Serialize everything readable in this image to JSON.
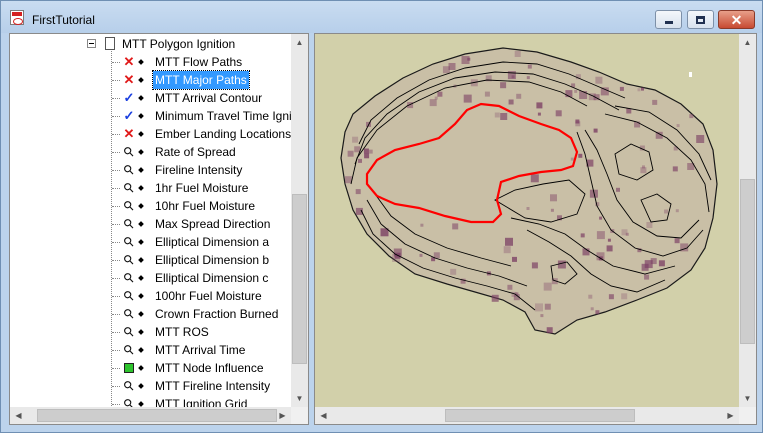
{
  "window": {
    "title": "FirstTutorial",
    "controls": {
      "minimize": "minimize",
      "maximize": "maximize",
      "close": "✕"
    }
  },
  "tree": {
    "root": {
      "label": "MTT Polygon Ignition",
      "expanded": true
    },
    "items": [
      {
        "label": "MTT Flow Paths",
        "icon": "x-icon",
        "selected": false
      },
      {
        "label": "MTT Major Paths",
        "icon": "x-icon",
        "selected": true
      },
      {
        "label": "MTT Arrival Contour",
        "icon": "check-icon",
        "selected": false
      },
      {
        "label": "Minimum Travel Time Igniti",
        "icon": "check-icon",
        "selected": false
      },
      {
        "label": "Ember Landing Locations",
        "icon": "x-icon",
        "selected": false
      },
      {
        "label": "Rate of Spread",
        "icon": "magnifier-icon",
        "selected": false
      },
      {
        "label": "Fireline Intensity",
        "icon": "magnifier-icon",
        "selected": false
      },
      {
        "label": "1hr Fuel Moisture",
        "icon": "magnifier-icon",
        "selected": false
      },
      {
        "label": "10hr Fuel Moisture",
        "icon": "magnifier-icon",
        "selected": false
      },
      {
        "label": "Max Spread Direction",
        "icon": "magnifier-icon",
        "selected": false
      },
      {
        "label": "Elliptical Dimension a",
        "icon": "magnifier-icon",
        "selected": false
      },
      {
        "label": "Elliptical Dimension b",
        "icon": "magnifier-icon",
        "selected": false
      },
      {
        "label": "Elliptical Dimension c",
        "icon": "magnifier-icon",
        "selected": false
      },
      {
        "label": "100hr Fuel Moisture",
        "icon": "magnifier-icon",
        "selected": false
      },
      {
        "label": "Crown Fraction Burned",
        "icon": "magnifier-icon",
        "selected": false
      },
      {
        "label": "MTT ROS",
        "icon": "magnifier-icon",
        "selected": false
      },
      {
        "label": "MTT Arrival Time",
        "icon": "magnifier-icon",
        "selected": false
      },
      {
        "label": "MTT Node Influence",
        "icon": "green-square-icon",
        "selected": false
      },
      {
        "label": "MTT Fireline Intensity",
        "icon": "magnifier-icon",
        "selected": false
      },
      {
        "label": "MTT Ignition Grid",
        "icon": "magnifier-icon",
        "selected": false
      }
    ]
  },
  "map": {
    "background_color": "#d2d0aa",
    "burn_fill_color": "#c9bfa6",
    "burn_dark_color": "#7a3d63",
    "ignition_outline_color": "#ff0000",
    "contour_color": "#000000"
  },
  "scroll_arrows": {
    "up": "▲",
    "down": "▼",
    "left": "◀",
    "right": "▶"
  }
}
